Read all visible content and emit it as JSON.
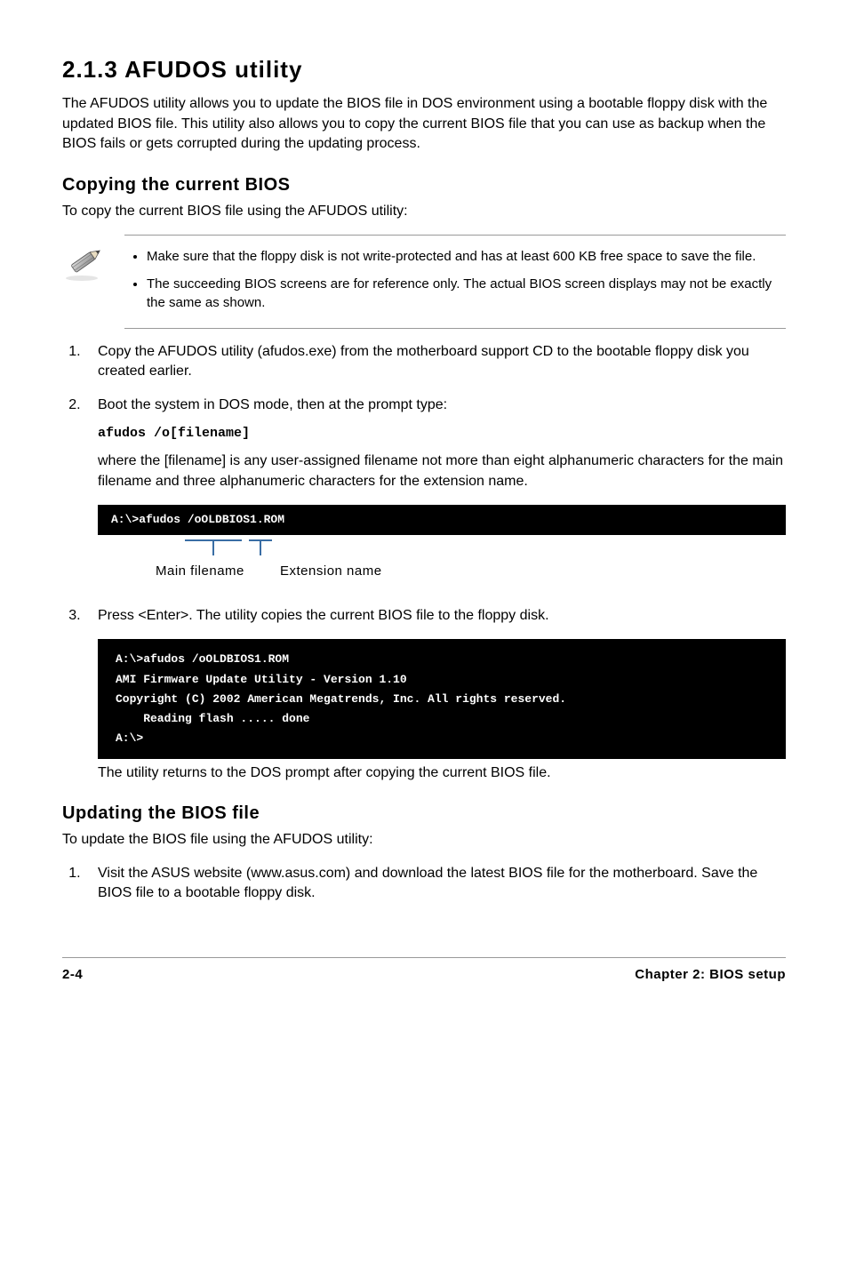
{
  "heading": "2.1.3   AFUDOS utility",
  "intro": "The AFUDOS utility allows you to update the BIOS file in DOS environment using a bootable floppy disk with the updated BIOS file. This utility also allows you to copy the current BIOS file that you can use as backup when the BIOS fails or gets corrupted during the updating process.",
  "copying": {
    "heading": "Copying the current BIOS",
    "intro": "To copy the current BIOS file using the AFUDOS utility:",
    "notes": [
      "Make sure that the floppy disk is not write-protected and has at least 600 KB free space to save the file.",
      "The succeeding BIOS screens are for reference only. The actual BIOS screen displays may not be exactly the same as shown."
    ],
    "step1": "Copy the AFUDOS utility (afudos.exe) from the motherboard support CD to the bootable floppy disk you created earlier.",
    "step2": "Boot the system in DOS mode, then at the prompt type:",
    "code": "afudos /o[filename]",
    "step2b": "where the [filename] is any user-assigned filename not more than eight alphanumeric characters  for the main filename and three alphanumeric characters for the extension name.",
    "terminal1": "A:\\>afudos /oOLDBIOS1.ROM",
    "label_main": "Main filename",
    "label_ext": "Extension name",
    "step3": "Press <Enter>. The utility copies the current BIOS file to the floppy disk.",
    "terminal2": "A:\\>afudos /oOLDBIOS1.ROM\nAMI Firmware Update Utility - Version 1.10\nCopyright (C) 2002 American Megatrends, Inc. All rights reserved.\n    Reading flash ..... done\nA:\\>",
    "after": "The utility returns to the DOS prompt after copying the current BIOS file."
  },
  "updating": {
    "heading": "Updating the BIOS file",
    "intro": "To update the BIOS file using the AFUDOS utility:",
    "step1": "Visit the ASUS website (www.asus.com) and download the latest BIOS file for the motherboard. Save the BIOS file to a bootable floppy disk."
  },
  "footer": {
    "left": "2-4",
    "right": "Chapter 2: BIOS setup"
  }
}
